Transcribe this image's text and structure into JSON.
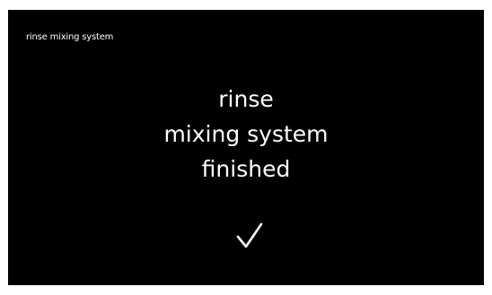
{
  "header": {
    "title": "rinse mixing system"
  },
  "message": {
    "lines": [
      "rinse",
      "mixing system",
      "finished"
    ]
  },
  "status": {
    "icon": "checkmark-icon",
    "color": "#ffffff"
  },
  "colors": {
    "background": "#000000",
    "text": "#ffffff"
  }
}
